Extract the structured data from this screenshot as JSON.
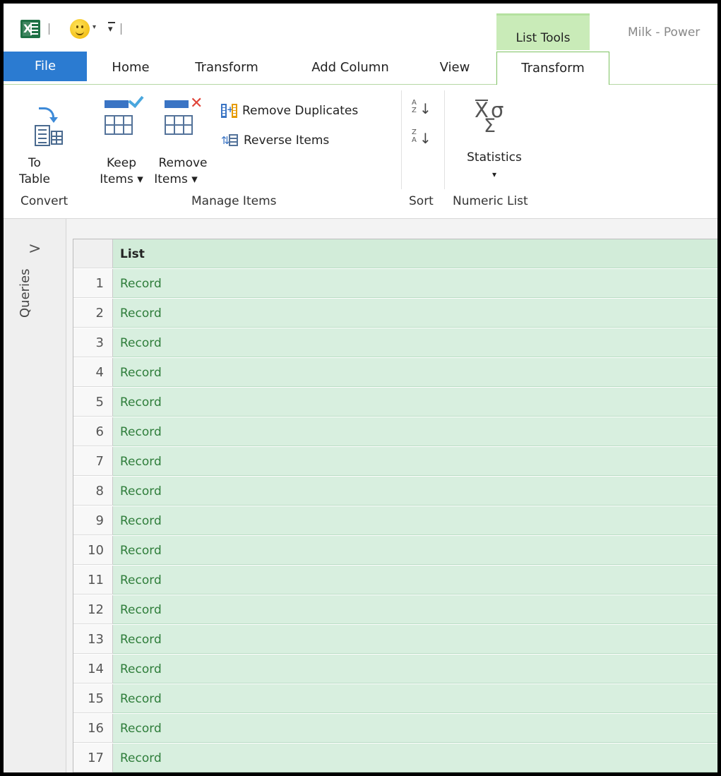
{
  "window": {
    "title": "Milk - Power",
    "context_tab_group": "List Tools"
  },
  "qat": {
    "app_icon": "excel-icon",
    "feedback_icon": "smiley-icon",
    "customize_icon": "customize-qat-icon"
  },
  "tabs": {
    "file": "File",
    "home": "Home",
    "transform": "Transform",
    "add_column": "Add Column",
    "view": "View",
    "list_transform": "Transform"
  },
  "ribbon": {
    "convert": {
      "group_label": "Convert",
      "to_table_line1": "To",
      "to_table_line2": "Table"
    },
    "manage_items": {
      "group_label": "Manage Items",
      "keep_line1": "Keep",
      "keep_line2": "Items ▾",
      "remove_line1": "Remove",
      "remove_line2": "Items ▾",
      "remove_duplicates": "Remove Duplicates",
      "reverse_items": "Reverse Items"
    },
    "sort": {
      "group_label": "Sort"
    },
    "numeric_list": {
      "group_label": "Numeric List",
      "statistics": "Statistics",
      "statistics_arrow": "▾"
    }
  },
  "queries_pane": {
    "label": "Queries",
    "chevron": ">"
  },
  "grid": {
    "column_header": "List",
    "rows": [
      {
        "n": "1",
        "v": "Record"
      },
      {
        "n": "2",
        "v": "Record"
      },
      {
        "n": "3",
        "v": "Record"
      },
      {
        "n": "4",
        "v": "Record"
      },
      {
        "n": "5",
        "v": "Record"
      },
      {
        "n": "6",
        "v": "Record"
      },
      {
        "n": "7",
        "v": "Record"
      },
      {
        "n": "8",
        "v": "Record"
      },
      {
        "n": "9",
        "v": "Record"
      },
      {
        "n": "10",
        "v": "Record"
      },
      {
        "n": "11",
        "v": "Record"
      },
      {
        "n": "12",
        "v": "Record"
      },
      {
        "n": "13",
        "v": "Record"
      },
      {
        "n": "14",
        "v": "Record"
      },
      {
        "n": "15",
        "v": "Record"
      },
      {
        "n": "16",
        "v": "Record"
      },
      {
        "n": "17",
        "v": "Record"
      }
    ]
  },
  "colors": {
    "file_tab": "#2b7bd1",
    "context_tab": "#c9ebb8",
    "cell_bg": "#d8efdf",
    "cell_text": "#2e7d3a"
  }
}
